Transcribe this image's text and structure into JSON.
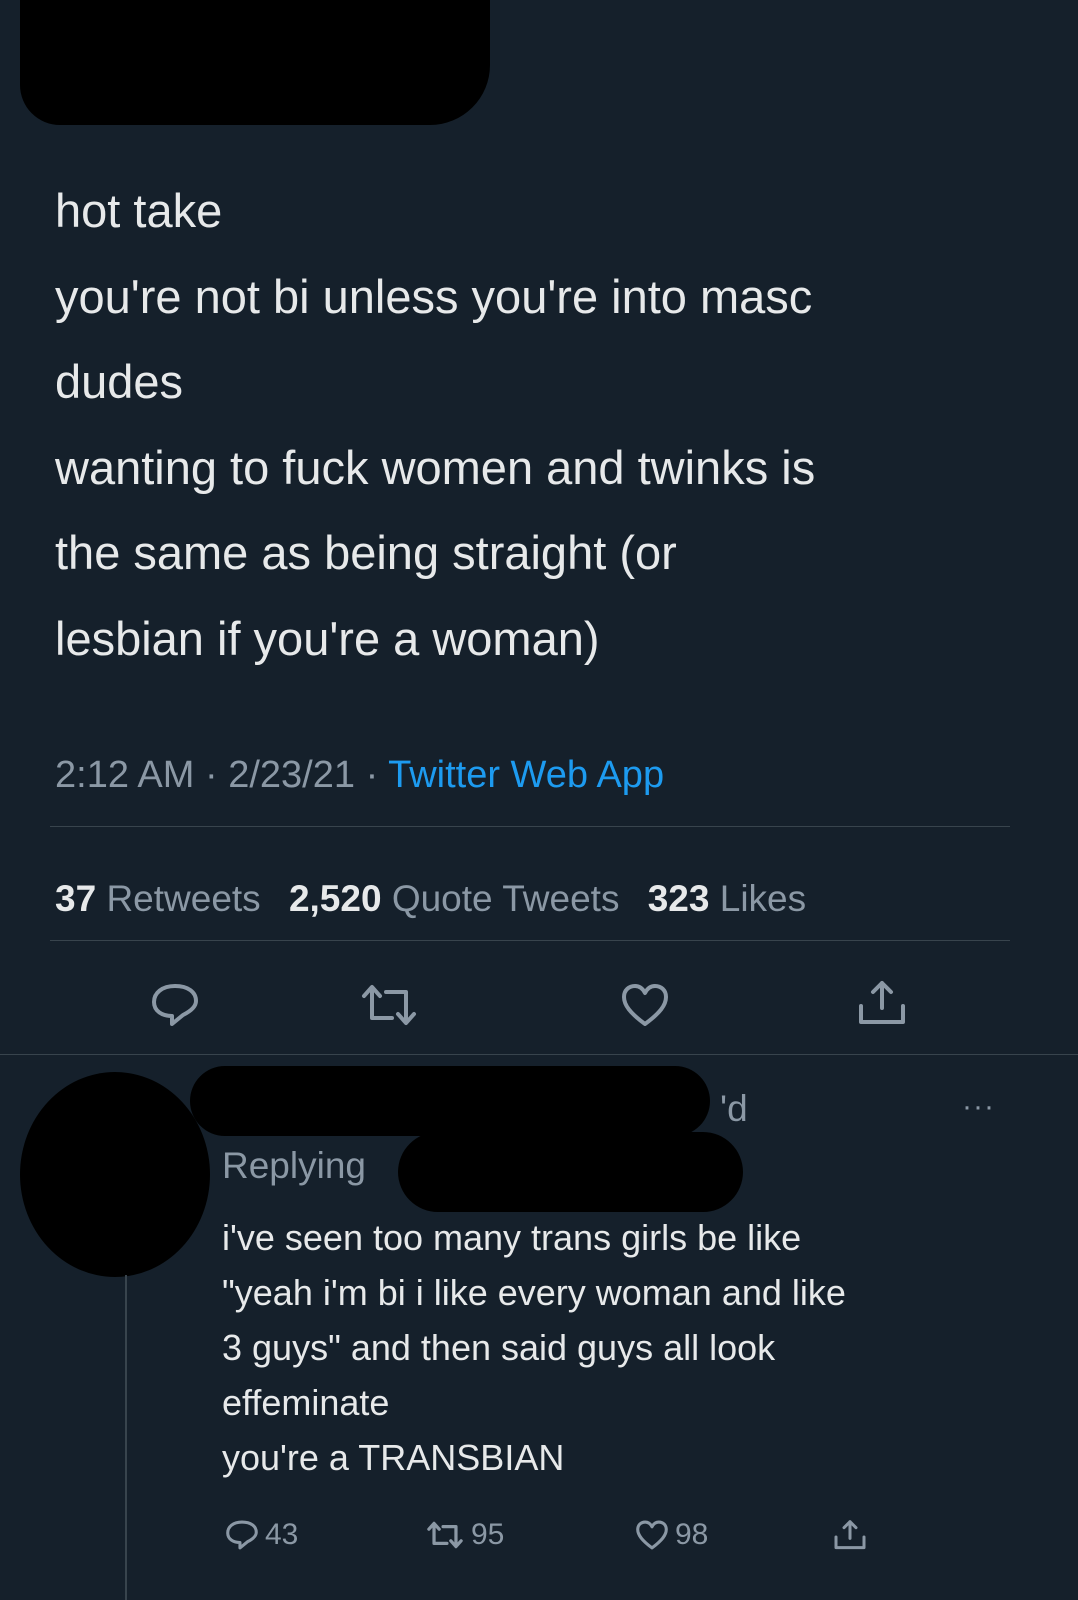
{
  "tweet": {
    "lines": [
      "hot take",
      "you're not bi unless you're into masc",
      "dudes",
      "wanting to fuck women and twinks is",
      "the same as being straight (or",
      "lesbian if you're a woman)"
    ],
    "time": "2:12 AM",
    "date": "2/23/21",
    "separator": "·",
    "source": "Twitter Web App",
    "stats": {
      "retweets_count": "37",
      "retweets_label": "Retweets",
      "quotes_count": "2,520",
      "quotes_label": "Quote Tweets",
      "likes_count": "323",
      "likes_label": "Likes"
    }
  },
  "reply": {
    "time_fragment": "'d",
    "more": "···",
    "replying_label": "Replying",
    "lines": [
      "i've seen too many trans girls be like",
      "\"yeah i'm bi i like every woman and like",
      "3 guys\" and then said guys all look",
      "effeminate",
      "you're a TRANSBIAN"
    ],
    "actions": {
      "replies": "43",
      "retweets": "95",
      "likes": "98"
    }
  },
  "colors": {
    "background": "#15202b",
    "text": "#e7e9ea",
    "secondary": "#8b98a5",
    "link": "#1d9bf0",
    "divider": "#38444d",
    "redaction": "#000000"
  },
  "icons": [
    "reply-icon",
    "retweet-icon",
    "like-icon",
    "share-icon",
    "more-icon"
  ]
}
